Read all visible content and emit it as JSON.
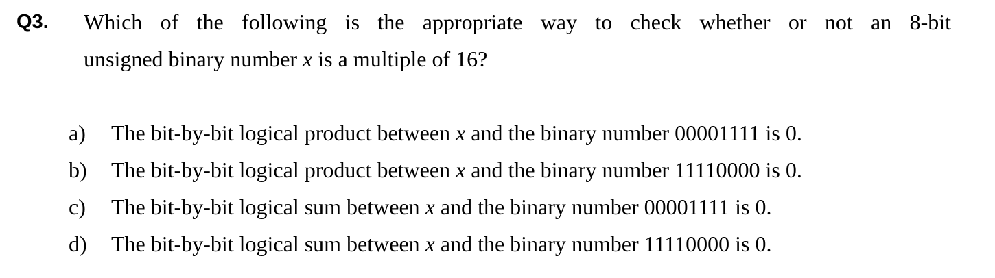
{
  "question": {
    "label": "Q3.",
    "line1": "Which of the following is the appropriate way to check whether or not an 8-bit",
    "line2_before": "unsigned binary number ",
    "variable": "x",
    "line2_after": " is a multiple of 16?"
  },
  "options": [
    {
      "letter": "a)",
      "before": "The bit-by-bit logical product between ",
      "variable": "x",
      "after": " and the binary number 00001111 is 0."
    },
    {
      "letter": "b)",
      "before": "The bit-by-bit logical product between ",
      "variable": "x",
      "after": " and the binary number 11110000 is 0."
    },
    {
      "letter": "c)",
      "before": "The bit-by-bit logical sum between ",
      "variable": "x",
      "after": " and the binary number 00001111 is 0."
    },
    {
      "letter": "d)",
      "before": "The bit-by-bit logical sum between ",
      "variable": "x",
      "after": " and the binary number 11110000 is 0."
    }
  ]
}
